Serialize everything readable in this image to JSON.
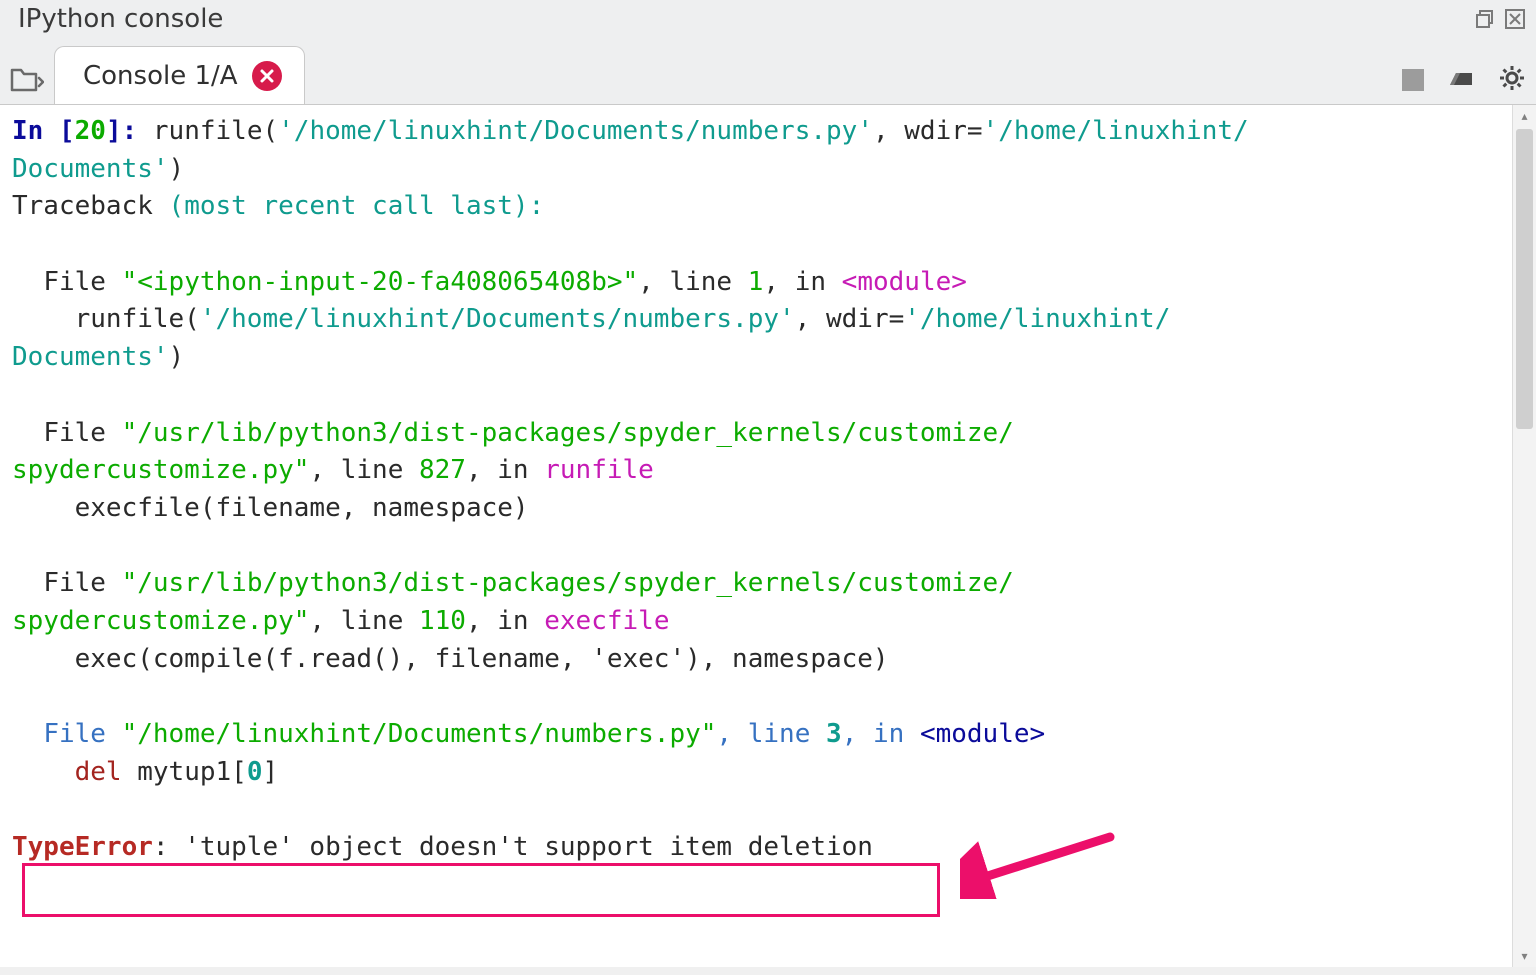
{
  "panel": {
    "title": "IPython console"
  },
  "tab": {
    "label": "Console 1/A"
  },
  "console": {
    "in_label": "In ",
    "in_num": "20",
    "runfile1a": "runfile(",
    "runfile1b": "'/home/linuxhint/Documents/numbers.py'",
    "runfile1c": ", wdir=",
    "runfile1d": "'/home/linuxhint/",
    "runfile1e": "Documents'",
    "runfile1f": ")",
    "tb_label": "Traceback ",
    "tb_paren": "(most recent call last):",
    "file_lbl": "File ",
    "f1_path": "\"<ipython-input-20-fa408065408b>\"",
    "f_line": ", line ",
    "f1_ln": "1",
    "f_in": ", in ",
    "mod": "<module>",
    "f1_body_a": "    runfile(",
    "f1_body_b": "'/home/linuxhint/Documents/numbers.py'",
    "f1_body_c": ", wdir=",
    "f1_body_d": "'/home/linuxhint/",
    "f1_body_e": "Documents'",
    "f1_body_f": ")",
    "f2_path_a": "\"/usr/lib/python3/dist-packages/spyder_kernels/customize/",
    "f2_path_b": "spydercustomize.py\"",
    "f2_ln": "827",
    "f2_fn": "runfile",
    "f2_body": "    execfile(filename, namespace)",
    "f3_ln": "110",
    "f3_fn": "execfile",
    "f3_body": "    exec(compile(f.read(), filename, 'exec'), namespace)",
    "f4_path": "\"/home/linuxhint/Documents/numbers.py\"",
    "f4_ln": "3",
    "f4_body_a": "    del",
    "f4_body_b": " mytup1[",
    "f4_body_c": "0",
    "f4_body_d": "]",
    "err_type": "TypeError",
    "err_msg": ": 'tuple' object doesn't support item deletion"
  }
}
